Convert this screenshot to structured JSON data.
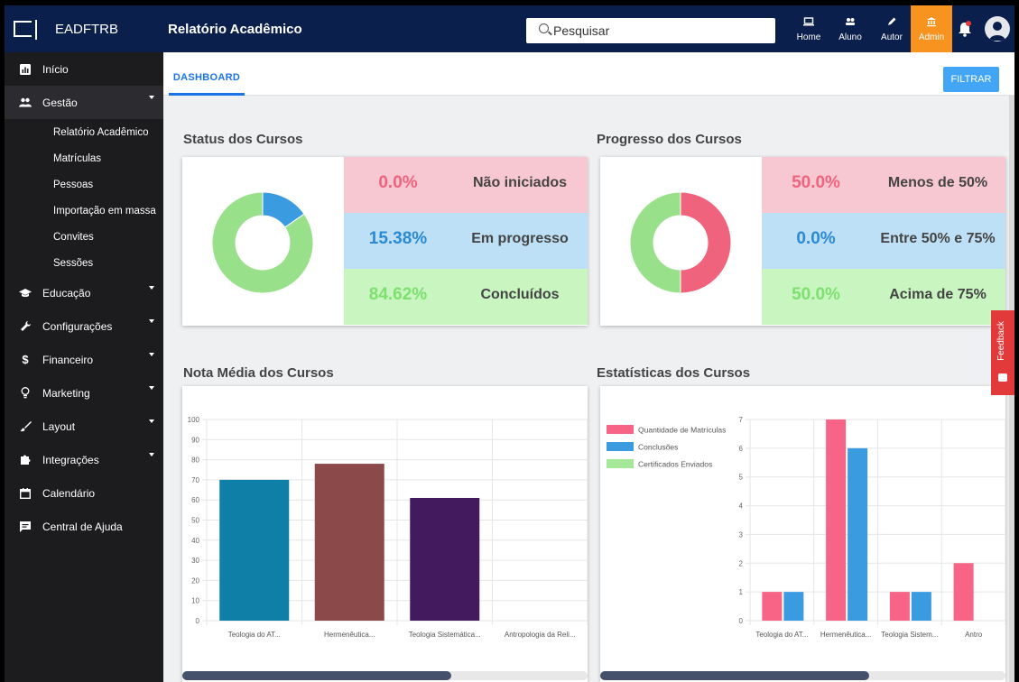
{
  "app": {
    "brand": "EADFTRB",
    "page_title": "Relatório Acadêmico"
  },
  "search": {
    "placeholder": "Pesquisar"
  },
  "topnav": [
    {
      "label": "Home",
      "icon": "laptop-icon"
    },
    {
      "label": "Aluno",
      "icon": "users-icon"
    },
    {
      "label": "Autor",
      "icon": "pencil-icon"
    },
    {
      "label": "Admin",
      "icon": "bank-icon",
      "active": true
    }
  ],
  "sidebar": {
    "items": [
      {
        "label": "Início",
        "icon": "dashboard-icon"
      },
      {
        "label": "Gestão",
        "icon": "people-icon",
        "expanded": true,
        "children": [
          "Relatório Acadêmico",
          "Matrículas",
          "Pessoas",
          "Importação em massa",
          "Convites",
          "Sessões"
        ]
      },
      {
        "label": "Educação",
        "icon": "graduation-cap-icon"
      },
      {
        "label": "Configurações",
        "icon": "wrench-icon"
      },
      {
        "label": "Financeiro",
        "icon": "dollar-icon"
      },
      {
        "label": "Marketing",
        "icon": "lightbulb-icon"
      },
      {
        "label": "Layout",
        "icon": "brush-icon"
      },
      {
        "label": "Integrações",
        "icon": "puzzle-icon"
      },
      {
        "label": "Calendário",
        "icon": "calendar-icon"
      },
      {
        "label": "Central de Ajuda",
        "icon": "chat-icon"
      }
    ]
  },
  "tabs": {
    "dashboard": "DASHBOARD",
    "filter": "FILTRAR"
  },
  "status_cursos": {
    "title": "Status dos Cursos",
    "rows": [
      {
        "pct": "0.0%",
        "label": "Não iniciados",
        "color": "#f0637d"
      },
      {
        "pct": "15.38%",
        "label": "Em progresso",
        "color": "#3a9be0"
      },
      {
        "pct": "84.62%",
        "label": "Concluídos",
        "color": "#98e08a"
      }
    ]
  },
  "progresso_cursos": {
    "title": "Progresso dos Cursos",
    "rows": [
      {
        "pct": "50.0%",
        "label": "Menos de 50%",
        "color": "#f0637d"
      },
      {
        "pct": "0.0%",
        "label": "Entre 50% e 75%",
        "color": "#3a9be0"
      },
      {
        "pct": "50.0%",
        "label": "Acima de 75%",
        "color": "#98e08a"
      }
    ]
  },
  "nota_media": {
    "title": "Nota Média dos Cursos"
  },
  "estatisticas": {
    "title": "Estatísticas dos Cursos"
  },
  "feedback": {
    "label": "Feedback"
  },
  "chart_data": [
    {
      "type": "pie",
      "labels": [
        "Não iniciados",
        "Em progresso",
        "Concluídos"
      ],
      "values": [
        0.0,
        15.38,
        84.62
      ],
      "colors": [
        "#f0637d",
        "#3a9be0",
        "#98e08a"
      ]
    },
    {
      "type": "pie",
      "labels": [
        "Menos de 50%",
        "Entre 50% e 75%",
        "Acima de 75%"
      ],
      "values": [
        50.0,
        0.0,
        50.0
      ],
      "colors": [
        "#f0637d",
        "#3a9be0",
        "#98e08a"
      ]
    },
    {
      "type": "bar",
      "categories": [
        "Teologia do AT...",
        "Hermenêutica...",
        "Teologia Sistemática...",
        "Antropologia da Reli..."
      ],
      "values": [
        70,
        78,
        61,
        0
      ],
      "colors": [
        "#0f7fa8",
        "#8b4a49",
        "#431a5e",
        "#cccccc"
      ],
      "ylim": [
        0,
        100
      ],
      "yticks": [
        0,
        10,
        20,
        30,
        40,
        50,
        60,
        70,
        80,
        90,
        100
      ]
    },
    {
      "type": "bar",
      "categories": [
        "Teologia do AT...",
        "Hermenêutica...",
        "Teologia Sistem...",
        "Antro"
      ],
      "series": [
        {
          "name": "Quantidade de Matrículas",
          "values": [
            1,
            7,
            1,
            2
          ],
          "color": "#f76486"
        },
        {
          "name": "Conclusões",
          "values": [
            1,
            6,
            1,
            0
          ],
          "color": "#3a9be0"
        },
        {
          "name": "Certificados Enviados",
          "values": [
            0,
            0,
            0,
            0
          ],
          "color": "#a5e897"
        }
      ],
      "ylim": [
        0,
        7
      ],
      "yticks": [
        0,
        1,
        2,
        3,
        4,
        5,
        6,
        7
      ],
      "legend": "top-left"
    }
  ]
}
